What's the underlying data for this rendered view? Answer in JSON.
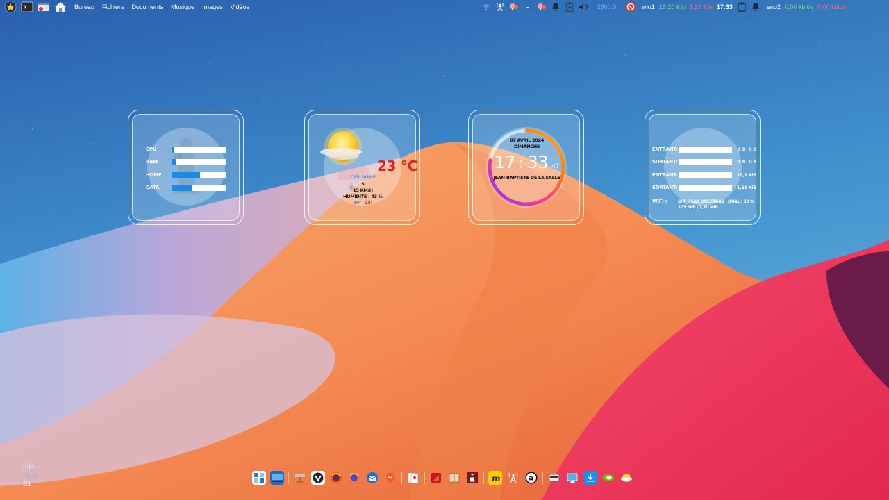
{
  "top_panel": {
    "menu": [
      {
        "label": "Bureau"
      },
      {
        "label": "Fichiers"
      },
      {
        "label": "Documents"
      },
      {
        "label": "Musique"
      },
      {
        "label": "Images"
      },
      {
        "label": "Vidéos"
      }
    ],
    "cpu_freq": "2600,0",
    "net_wlo1": {
      "iface": "wlo1",
      "down": "18,20 Kio",
      "up": "1,32 Kio"
    },
    "clock": "17:33",
    "net_eno2": {
      "iface": "eno2",
      "down": "0,00 kbit/s",
      "up": "0,00 kbit/s"
    },
    "colors": {
      "down": "#7bd67b",
      "up": "#ff6b6b",
      "cpu": "#6fa8ff"
    }
  },
  "system_widget": {
    "rows": [
      {
        "label": "CPU",
        "fill": 0.05
      },
      {
        "label": "RAM",
        "fill": 0.08
      },
      {
        "label": "HOME",
        "fill": 0.53
      },
      {
        "label": "DATA",
        "fill": 0.37
      }
    ]
  },
  "weather_widget": {
    "temperature": "23 °C",
    "condition": "CIEL VOILÉ",
    "wind_dir": "S",
    "wind_speed": "15 KM/H",
    "humidity": "HUMIDITÉ : 43 %",
    "temp_min": "10°",
    "temp_max": "23°",
    "colors": {
      "temp": "#e02020",
      "condition": "#5b8ed6",
      "min": "#3b82f6",
      "max": "#e02020"
    }
  },
  "clock_widget": {
    "date": "07 AVRIL 2024",
    "weekday": "DIMANCHE",
    "hours": "17",
    "minutes": "33",
    "seconds": "47",
    "saint": "JEAN-BAPTISTE DE LA SALLE",
    "seconds_fraction": 0.78
  },
  "network_widget": {
    "rows": [
      {
        "label": "ENTRANT:",
        "value": "0 B  |  0 B"
      },
      {
        "label": "SORTANT:",
        "value": "0 B  |  0 B"
      },
      {
        "label": "ENTRANT:",
        "value": "18,2 KiB"
      },
      {
        "label": "SORTANT:",
        "value": "1,61 KiB"
      }
    ],
    "wifi_label": "WIFI :",
    "wifi_line1": "SFR_76A8_2GEXTBAS  |  QUAL : 53 %",
    "wifi_line2": "103 MiB  |  7,70 MiB"
  },
  "dock": {
    "icons": [
      "workspace-switcher-icon",
      "show-desktop-icon",
      "sep",
      "package-manager-icon",
      "vivaldi-icon",
      "firefox-esr-icon",
      "firefox-icon",
      "thunderbird-icon",
      "brave-icon",
      "sep",
      "solitaire-game-icon",
      "sep",
      "red-game-icon",
      "mahjong-icon",
      "chess-icon",
      "sep",
      "m-app-icon",
      "radio-tower-icon",
      "amazon-icon",
      "sep",
      "scanner-icon",
      "remote-desktop-icon",
      "download-icon",
      "nvidia-icon",
      "weather-app-icon"
    ]
  },
  "lock_keys": {
    "min": "min",
    "num": "Num",
    "b1": "B1"
  }
}
